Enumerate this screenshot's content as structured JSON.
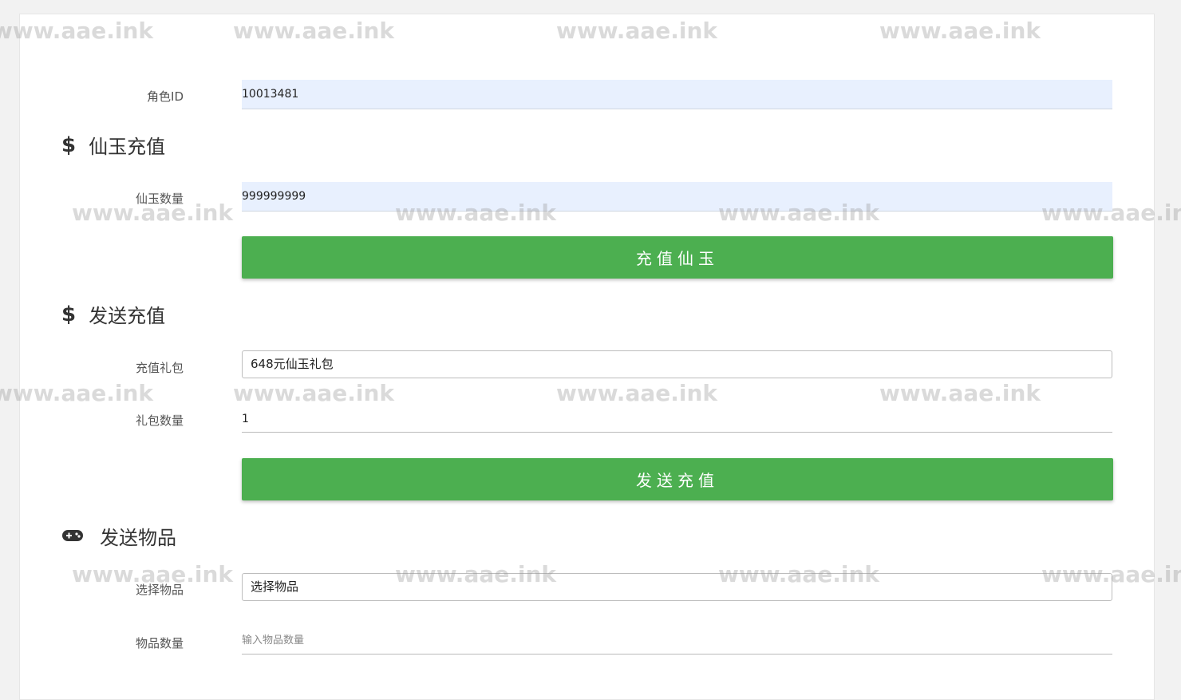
{
  "form": {
    "role_id": {
      "label": "角色ID",
      "value": "10013481"
    },
    "xianyu_section": {
      "title": "仙玉充值",
      "icon": "dollar-icon",
      "amount_label": "仙玉数量",
      "amount_value": "999999999",
      "button_label": "充值仙玉"
    },
    "recharge_section": {
      "title": "发送充值",
      "icon": "dollar-icon",
      "package_label": "充值礼包",
      "package_value": "648元仙玉礼包",
      "count_label": "礼包数量",
      "count_value": "1",
      "button_label": "发送充值"
    },
    "item_section": {
      "title": "发送物品",
      "icon": "gamepad-icon",
      "select_label": "选择物品",
      "select_value": "选择物品",
      "quantity_label": "物品数量",
      "quantity_placeholder": "输入物品数量"
    }
  },
  "watermark": "www.aae.ink",
  "colors": {
    "button": "#4caf50",
    "autofill": "#e8f0fe",
    "background": "#f2f2f2"
  }
}
